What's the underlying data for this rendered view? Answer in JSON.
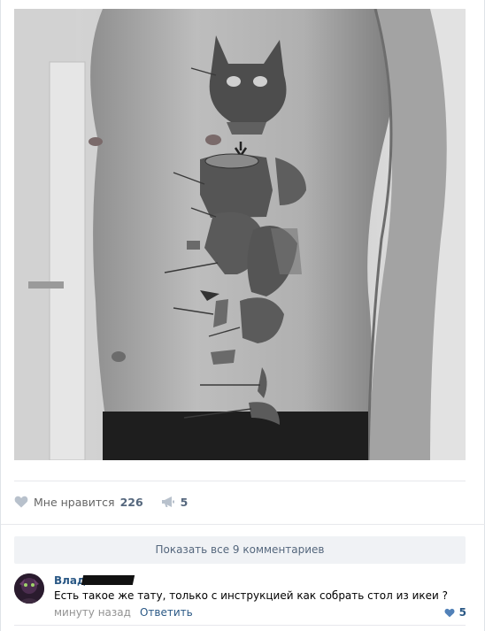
{
  "post": {
    "photo_icon": "tattoo-photo"
  },
  "actions": {
    "like_label": "Мне нравится",
    "like_count": "226",
    "share_count": "5",
    "like_icon": "heart-icon",
    "share_icon": "megaphone-icon"
  },
  "comments": {
    "show_all_label": "Показать все 9 комментариев",
    "items": [
      {
        "author": "Влад",
        "text": "Есть такое же тату, только с инструкцией как собрать стол из икеи ?",
        "time": "минуту назад",
        "reply_label": "Ответить",
        "likes": "5"
      }
    ]
  },
  "colors": {
    "link": "#2a5885",
    "muted": "#939393",
    "button_bg": "#f0f2f5",
    "like_icon": "#b8c1cc"
  }
}
